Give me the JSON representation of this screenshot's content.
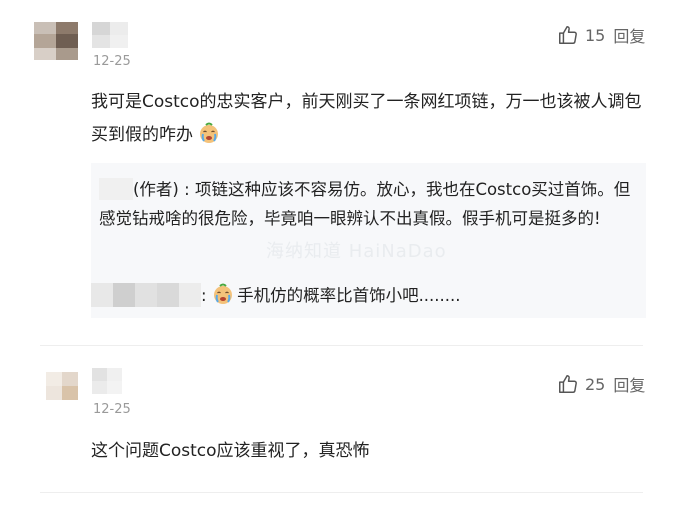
{
  "comments": [
    {
      "date": "12-25",
      "likes": "15",
      "reply_label": "回复",
      "text": "我可是Costco的忠实客户，前天刚买了一条网红项链，万一也该被人调包买到假的咋办",
      "emoji_icon": "crying-face",
      "replies": [
        {
          "author_tag": "(作者) : ",
          "text": "项链这种应该不容易仿。放心，我也在Costco买过首饰。但感觉钻戒啥的很危险，毕竟咱一眼辨认不出真假。假手机可是挺多的!"
        },
        {
          "author_tag": ": ",
          "text": "手机仿的概率比首饰小吧........",
          "emoji_icon": "crying-face"
        }
      ]
    },
    {
      "date": "12-25",
      "likes": "25",
      "reply_label": "回复",
      "text": "这个问题Costco应该重视了，真恐怖"
    }
  ],
  "watermark": "海纳知道 HaiNaDao",
  "colors": {
    "quote_bg": "#f7f8fa",
    "text": "#222222",
    "muted": "#9a9a9a",
    "separator": "#eeeeee"
  }
}
